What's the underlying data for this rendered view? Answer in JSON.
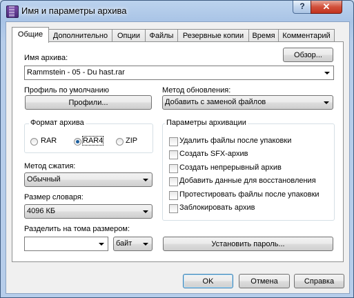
{
  "window": {
    "title": "Имя и параметры архива",
    "help": "?",
    "close": "✕"
  },
  "tabs": [
    {
      "label": "Общие"
    },
    {
      "label": "Дополнительно"
    },
    {
      "label": "Опции"
    },
    {
      "label": "Файлы"
    },
    {
      "label": "Резервные копии"
    },
    {
      "label": "Время"
    },
    {
      "label": "Комментарий"
    }
  ],
  "archive_name": {
    "label": "Имя архива:",
    "browse": "Обзор...",
    "value": "Rammstein - 05 - Du hast.rar"
  },
  "profile": {
    "label": "Профиль по умолчанию",
    "button": "Профили..."
  },
  "update_method": {
    "label": "Метод обновления:",
    "value": "Добавить с заменой файлов"
  },
  "archive_format": {
    "title": "Формат архива",
    "options": [
      "RAR",
      "RAR4",
      "ZIP"
    ],
    "selected": "RAR4"
  },
  "compression": {
    "label": "Метод сжатия:",
    "value": "Обычный"
  },
  "dictionary": {
    "label": "Размер словаря:",
    "value": "4096 КБ"
  },
  "split": {
    "label": "Разделить на тома размером:",
    "value": "",
    "unit": "байт"
  },
  "options": {
    "title": "Параметры архивации",
    "items": [
      {
        "label": "Удалить файлы после упаковки",
        "checked": false
      },
      {
        "label": "Создать SFX-архив",
        "checked": false
      },
      {
        "label": "Создать непрерывный архив",
        "checked": false
      },
      {
        "label": "Добавить данные для восстановления",
        "checked": false
      },
      {
        "label": "Протестировать файлы после упаковки",
        "checked": false
      },
      {
        "label": "Заблокировать архив",
        "checked": false
      }
    ]
  },
  "set_password": "Установить пароль...",
  "footer": {
    "ok": "OK",
    "cancel": "Отмена",
    "help": "Справка"
  }
}
